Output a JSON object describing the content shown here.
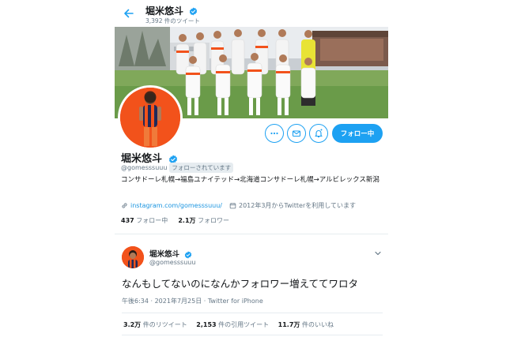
{
  "header": {
    "name": "堀米悠斗",
    "tweet_count": "3,392 件のツイート"
  },
  "profile": {
    "name": "堀米悠斗",
    "handle": "@gomesssuuu",
    "follows_you": "フォローされています",
    "bio": "コンサドーレ札幌→福島ユナイテッド→北海道コンサドーレ札幌→アルビレックス新潟",
    "link": "instagram.com/gomesssuuu/",
    "joined": "2012年3月からTwitterを利用しています",
    "following_count": "437",
    "following_label": "フォロー中",
    "followers_count": "2.1万",
    "followers_label": "フォロワー",
    "follow_button": "フォロー中"
  },
  "tweet": {
    "name": "堀米悠斗",
    "handle": "@gomesssuuu",
    "text": "なんもしてないのになんかフォロワー増えててワロタ",
    "timestamp": "午後6:34 · 2021年7月25日 · Twitter for iPhone",
    "retweets_count": "3.2万",
    "retweets_label": "件のリツイート",
    "quotes_count": "2,153",
    "quotes_label": "件の引用ツイート",
    "likes_count": "11.7万",
    "likes_label": "件のいいね"
  },
  "colors": {
    "accent": "#1da1f2",
    "team_orange": "#f2521b",
    "muted_text": "#657786"
  },
  "icons": [
    "back-arrow-icon",
    "verified-badge-icon",
    "more-icon",
    "message-icon",
    "notification-bell-icon",
    "link-icon",
    "calendar-icon",
    "chevron-down-icon"
  ]
}
